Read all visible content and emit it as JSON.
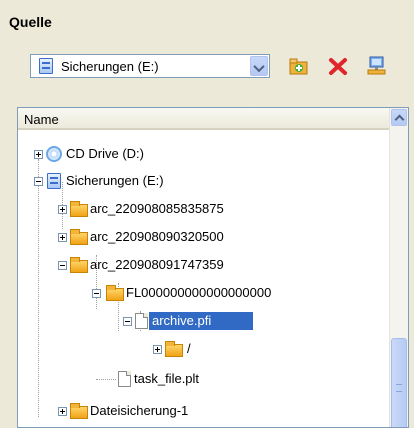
{
  "panel": {
    "title": "Quelle",
    "source_select": {
      "value": "Sicherungen (E:)"
    },
    "toolbar": {
      "add_icon": "folder-add-icon",
      "delete_icon": "red-x-icon",
      "network_icon": "network-computer-icon"
    }
  },
  "tree": {
    "column_header": "Name",
    "items": [
      {
        "label": "CD Drive (D:)",
        "icon": "cd-drive-icon",
        "expander": "plus"
      },
      {
        "label": "Sicherungen (E:)",
        "icon": "drive-icon",
        "expander": "minus"
      },
      {
        "label": "arc_220908085835875",
        "icon": "folder-icon",
        "expander": "plus"
      },
      {
        "label": "arc_220908090320500",
        "icon": "folder-icon",
        "expander": "plus"
      },
      {
        "label": "arc_220908091747359",
        "icon": "folder-icon",
        "expander": "minus"
      },
      {
        "label": "FL000000000000000000",
        "icon": "folder-icon",
        "expander": "minus"
      },
      {
        "label": "archive.pfi",
        "icon": "file-icon",
        "expander": "minus",
        "selected": true
      },
      {
        "label": "/",
        "icon": "folder-icon",
        "expander": "plus"
      },
      {
        "label": "task_file.plt",
        "icon": "file-icon"
      },
      {
        "label": "Dateisicherung-1",
        "icon": "folder-icon",
        "expander": "plus"
      }
    ]
  },
  "colors": {
    "selection": "#316ac5",
    "window_bg": "#ece9d8",
    "border": "#7f9db9"
  }
}
